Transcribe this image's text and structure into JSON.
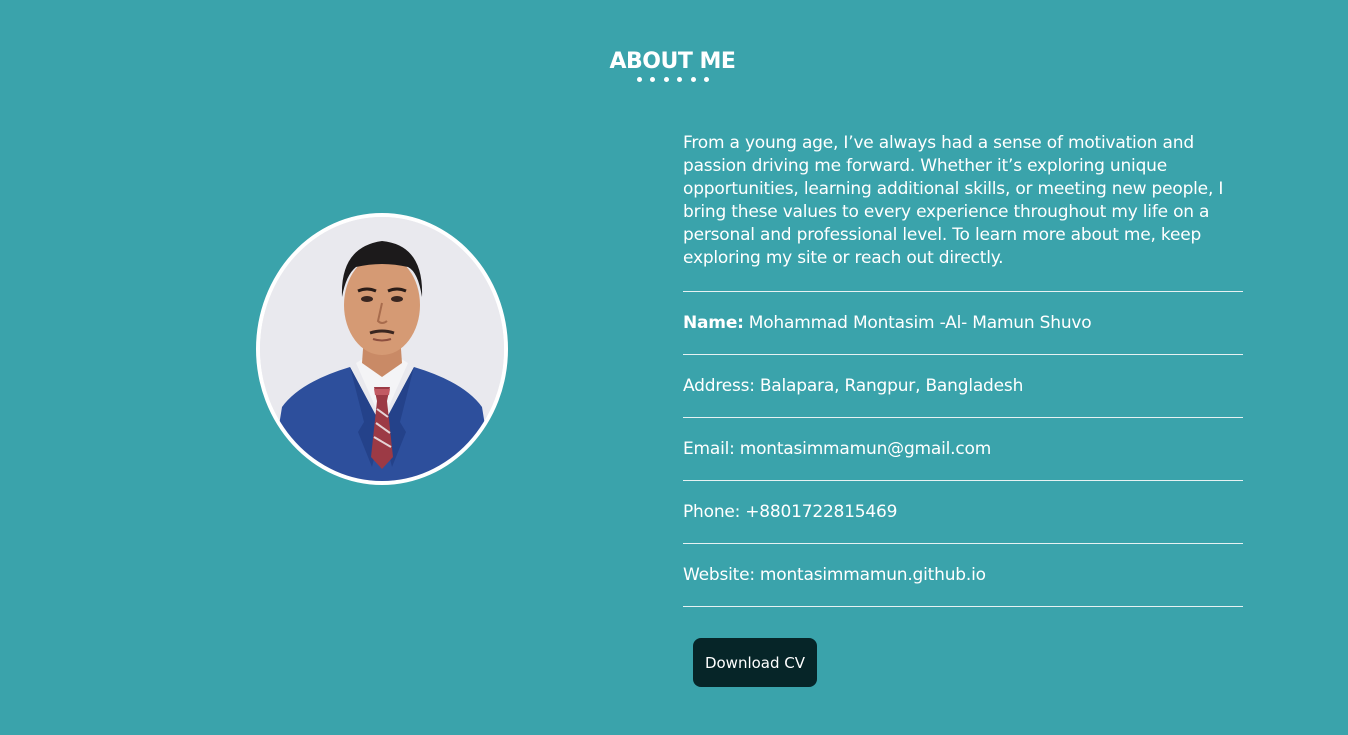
{
  "section": {
    "title": "ABOUT ME"
  },
  "profile": {
    "photo_icon": "person-photo"
  },
  "bio": "From a young age, I’ve always had a sense of motivation and passion driving me forward. Whether it’s exploring unique opportunities, learning additional skills, or meeting new people, I bring these values to every experience throughout my life on a personal and professional level. To learn more about me, keep exploring my site or reach out directly.",
  "info": {
    "name_label": "Name:",
    "name_value": "Mohammad Montasim -Al- Mamun Shuvo",
    "address_label": "Address:",
    "address_value": "Balapara, Rangpur, Bangladesh",
    "email_label": "Email:",
    "email_value": "montasimmamun@gmail.com",
    "phone_label": "Phone:",
    "phone_value": "+8801722815469",
    "website_label": "Website:",
    "website_value": "montasimmamun.github.io"
  },
  "actions": {
    "download_cv": "Download CV"
  },
  "colors": {
    "background": "#3aa3ab",
    "button": "#062528",
    "text": "#ffffff"
  }
}
